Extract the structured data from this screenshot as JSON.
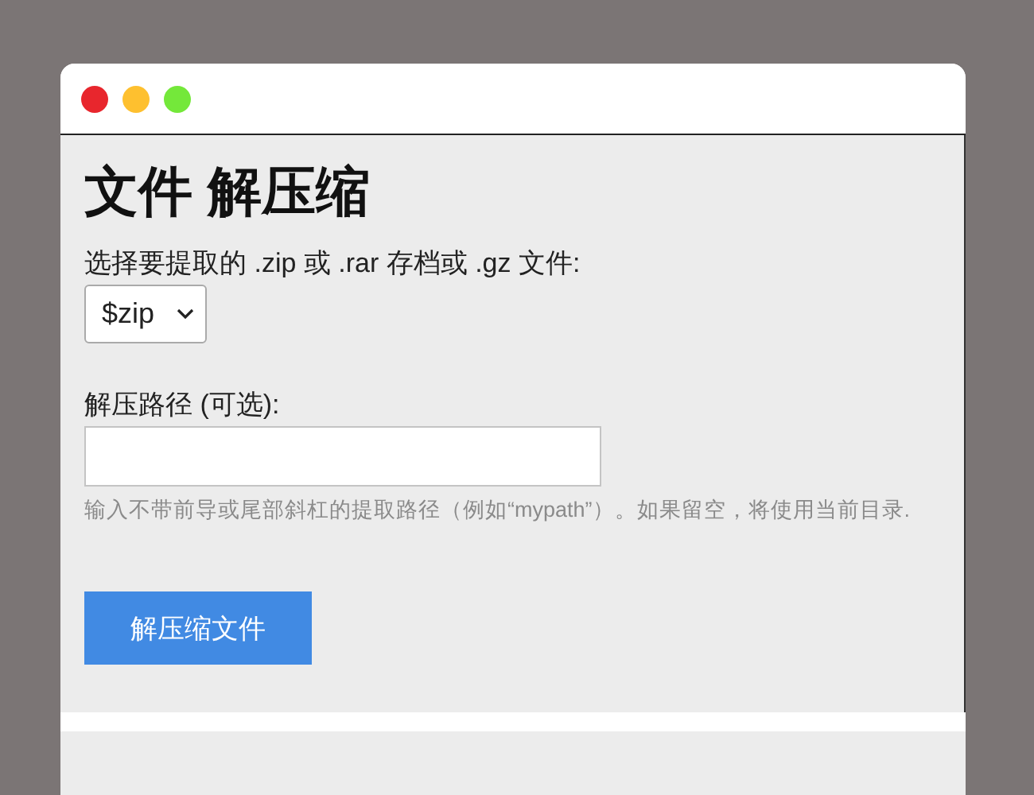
{
  "window": {
    "controls": [
      {
        "color": "#e8262d"
      },
      {
        "color": "#fec02f"
      },
      {
        "color": "#74e83a"
      }
    ]
  },
  "heading": "文件 解压缩",
  "archive_select": {
    "label": "选择要提取的 .zip 或 .rar 存档或 .gz 文件:",
    "value": "$zip"
  },
  "path_field": {
    "label": "解压路径 (可选):",
    "hint": "输入不带前导或尾部斜杠的提取路径（例如“mypath”）。如果留空，将使用当前目录."
  },
  "submit_button": "解压缩文件"
}
